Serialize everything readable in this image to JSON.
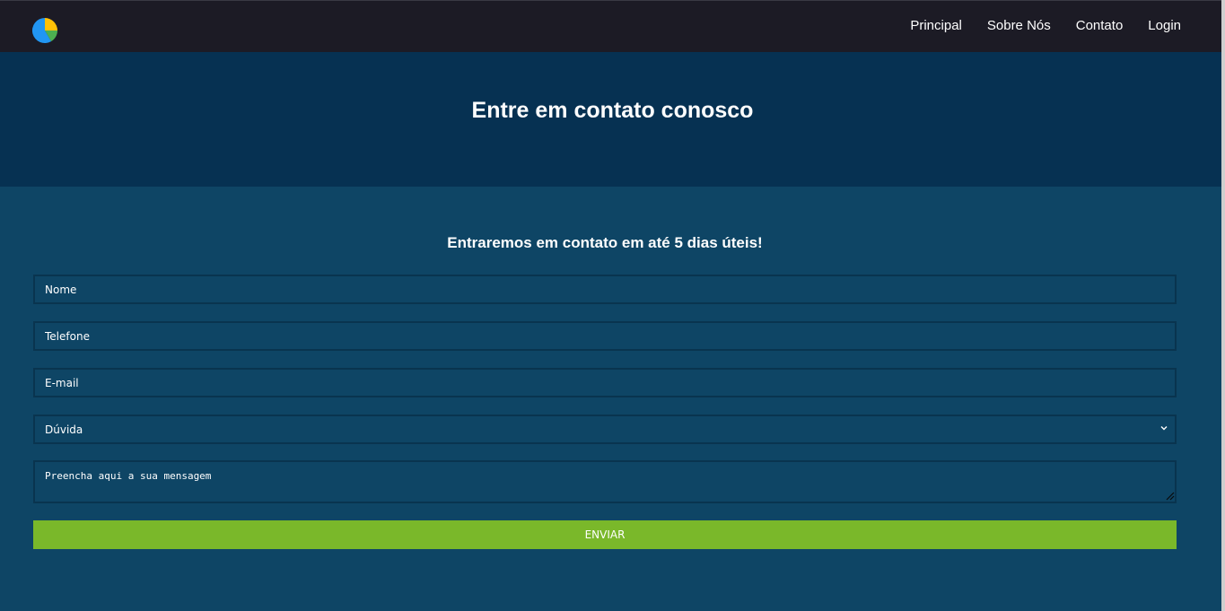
{
  "navbar": {
    "logo_icon": "pie-chart-icon",
    "links": [
      {
        "label": "Principal"
      },
      {
        "label": "Sobre Nós"
      },
      {
        "label": "Contato"
      },
      {
        "label": "Login"
      }
    ]
  },
  "hero": {
    "title": "Entre em contato conosco"
  },
  "form": {
    "subtitle": "Entraremos em contato em até 5 dias úteis!",
    "name_placeholder": "Nome",
    "phone_placeholder": "Telefone",
    "email_placeholder": "E-mail",
    "subject_selected": "Dúvida",
    "message_placeholder": "Preencha aqui a sua mensagem",
    "submit_label": "ENVIAR"
  },
  "colors": {
    "navbar_bg": "#1c1b25",
    "hero_bg": "#063152",
    "page_bg": "#0e4565",
    "button_bg": "#7ab82a",
    "logo_blue": "#2196f3",
    "logo_yellow": "#ffc107",
    "logo_green": "#4caf50"
  }
}
